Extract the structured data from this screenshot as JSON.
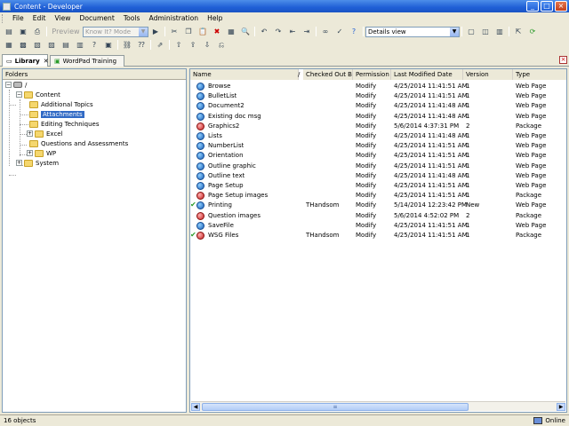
{
  "window": {
    "title": "Content - Developer"
  },
  "menus": [
    "File",
    "Edit",
    "View",
    "Document",
    "Tools",
    "Administration",
    "Help"
  ],
  "toolbar1": {
    "preview_label": "Preview",
    "mode_value": "Know It? Mode",
    "view_value": "Details view"
  },
  "tabs": [
    {
      "label": "Library"
    },
    {
      "label": "WordPad Training"
    }
  ],
  "folders": {
    "header": "Folders",
    "root": "/",
    "items": [
      {
        "label": "Content"
      },
      {
        "label": "Additional Topics"
      },
      {
        "label": "Attachments"
      },
      {
        "label": "Editing Techniques"
      },
      {
        "label": "Excel"
      },
      {
        "label": "Questions and Assessments"
      },
      {
        "label": "WP"
      },
      {
        "label": "System"
      }
    ]
  },
  "columns": [
    "Name",
    "/",
    "Checked Out By",
    "Permission",
    "Last Modified Date",
    "Version",
    "Type"
  ],
  "rows": [
    {
      "name": "Browse",
      "checked_out_by": "",
      "permission": "Modify",
      "date": "4/25/2014 11:41:51 AM",
      "version": "1",
      "type": "Web Page",
      "icon": "web",
      "checked": false
    },
    {
      "name": "BulletList",
      "checked_out_by": "",
      "permission": "Modify",
      "date": "4/25/2014 11:41:51 AM",
      "version": "1",
      "type": "Web Page",
      "icon": "web",
      "checked": false
    },
    {
      "name": "Document2",
      "checked_out_by": "",
      "permission": "Modify",
      "date": "4/25/2014 11:41:48 AM",
      "version": "1",
      "type": "Web Page",
      "icon": "web",
      "checked": false
    },
    {
      "name": "Existing doc msg",
      "checked_out_by": "",
      "permission": "Modify",
      "date": "4/25/2014 11:41:48 AM",
      "version": "1",
      "type": "Web Page",
      "icon": "web",
      "checked": false
    },
    {
      "name": "Graphics2",
      "checked_out_by": "",
      "permission": "Modify",
      "date": "5/6/2014 4:37:31 PM",
      "version": "2",
      "type": "Package",
      "icon": "pkg",
      "checked": false
    },
    {
      "name": "Lists",
      "checked_out_by": "",
      "permission": "Modify",
      "date": "4/25/2014 11:41:48 AM",
      "version": "1",
      "type": "Web Page",
      "icon": "web",
      "checked": false
    },
    {
      "name": "NumberList",
      "checked_out_by": "",
      "permission": "Modify",
      "date": "4/25/2014 11:41:51 AM",
      "version": "1",
      "type": "Web Page",
      "icon": "web",
      "checked": false
    },
    {
      "name": "Orientation",
      "checked_out_by": "",
      "permission": "Modify",
      "date": "4/25/2014 11:41:51 AM",
      "version": "1",
      "type": "Web Page",
      "icon": "web",
      "checked": false
    },
    {
      "name": "Outline graphic",
      "checked_out_by": "",
      "permission": "Modify",
      "date": "4/25/2014 11:41:51 AM",
      "version": "1",
      "type": "Web Page",
      "icon": "web",
      "checked": false
    },
    {
      "name": "Outline text",
      "checked_out_by": "",
      "permission": "Modify",
      "date": "4/25/2014 11:41:48 AM",
      "version": "1",
      "type": "Web Page",
      "icon": "web",
      "checked": false
    },
    {
      "name": "Page Setup",
      "checked_out_by": "",
      "permission": "Modify",
      "date": "4/25/2014 11:41:51 AM",
      "version": "1",
      "type": "Web Page",
      "icon": "web",
      "checked": false
    },
    {
      "name": "Page Setup images",
      "checked_out_by": "",
      "permission": "Modify",
      "date": "4/25/2014 11:41:51 AM",
      "version": "1",
      "type": "Package",
      "icon": "pkg",
      "checked": false
    },
    {
      "name": "Printing",
      "checked_out_by": "THandsom",
      "permission": "Modify",
      "date": "5/14/2014 12:23:42 PM",
      "version": "New",
      "type": "Web Page",
      "icon": "web",
      "checked": true
    },
    {
      "name": "Question images",
      "checked_out_by": "",
      "permission": "Modify",
      "date": "5/6/2014 4:52:02 PM",
      "version": "2",
      "type": "Package",
      "icon": "pkg",
      "checked": false
    },
    {
      "name": "SaveFile",
      "checked_out_by": "",
      "permission": "Modify",
      "date": "4/25/2014 11:41:51 AM",
      "version": "1",
      "type": "Web Page",
      "icon": "web",
      "checked": false
    },
    {
      "name": "WSG Files",
      "checked_out_by": "THandsom",
      "permission": "Modify",
      "date": "4/25/2014 11:41:51 AM",
      "version": "1",
      "type": "Package",
      "icon": "pkg",
      "checked": true
    }
  ],
  "status": {
    "count": "16 objects",
    "connection": "Online"
  }
}
